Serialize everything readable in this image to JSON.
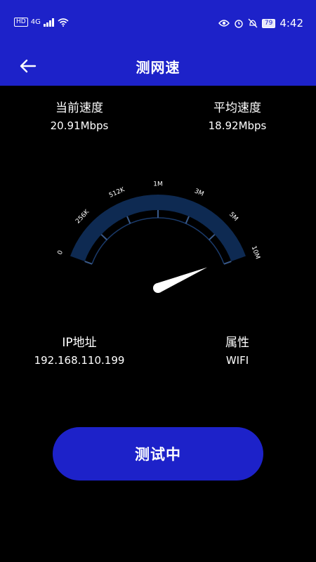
{
  "status_bar": {
    "left_badge": "HD",
    "network": "4G",
    "battery": "79",
    "time": "4:42"
  },
  "app_bar": {
    "title": "测网速",
    "back_icon": "arrow-left-icon"
  },
  "stats": {
    "current_speed": {
      "label": "当前速度",
      "value": "20.91Mbps"
    },
    "average_speed": {
      "label": "平均速度",
      "value": "18.92Mbps"
    },
    "ip_address": {
      "label": "IP地址",
      "value": "192.168.110.199"
    },
    "attribute": {
      "label": "属性",
      "value": "WIFI"
    }
  },
  "gauge": {
    "tick_labels": [
      "0",
      "256K",
      "512K",
      "1M",
      "3M",
      "5M",
      "10M"
    ],
    "needle_fraction": 0.98,
    "colors": {
      "arc": "#0e2a52",
      "inner": "#1a3a6a",
      "needle": "#ffffff"
    }
  },
  "action_button": {
    "label": "测试中"
  },
  "colors": {
    "primary": "#1d22c9",
    "background": "#000000"
  }
}
